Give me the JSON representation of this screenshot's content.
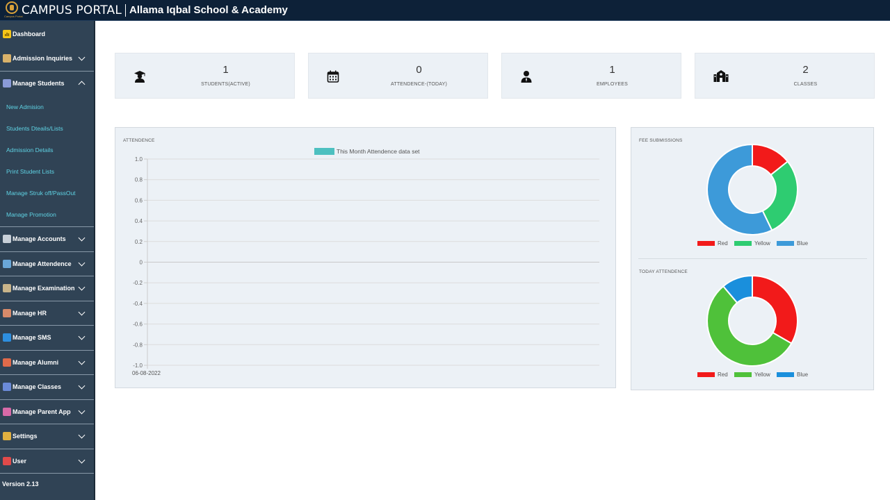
{
  "header": {
    "brand": "CAMPUS PORTAL",
    "logo_caption": "Campus Portal",
    "school": "Allama Iqbal School & Academy"
  },
  "sidebar": {
    "dashboard": {
      "label": "Dashboard",
      "icon": "dashboard-icon",
      "color": "#f5c518"
    },
    "items": [
      {
        "label": "Admission Inquiries",
        "icon": "inquiries-icon",
        "color": "#d9b26a"
      },
      {
        "label": "Manage Students",
        "icon": "students-icon",
        "color": "#8a9bd8",
        "expanded": true,
        "children": [
          "New Admision",
          "Students Dteails/Lists",
          "Admission Details",
          "Print Student Lists",
          "Manage Struk off/PassOut",
          "Manage Promotion"
        ]
      },
      {
        "label": "Manage Accounts",
        "icon": "bank-icon",
        "color": "#c8d0d8"
      },
      {
        "label": "Manage Attendence",
        "icon": "attendance-icon",
        "color": "#6aa7d8"
      },
      {
        "label": "Manage Examination",
        "icon": "exam-icon",
        "color": "#c8b48a"
      },
      {
        "label": "Manage HR",
        "icon": "hr-icon",
        "color": "#d88a6a"
      },
      {
        "label": "Manage SMS",
        "icon": "sms-icon",
        "color": "#2d8fe0"
      },
      {
        "label": "Manage Alumni",
        "icon": "alumni-icon",
        "color": "#e06a4a"
      },
      {
        "label": "Manage Classes",
        "icon": "classes-icon",
        "color": "#6a8ad8"
      },
      {
        "label": "Manage Parent App",
        "icon": "parent-app-icon",
        "color": "#d86aa8"
      },
      {
        "label": "Settings",
        "icon": "settings-icon",
        "color": "#e0b040"
      },
      {
        "label": "User",
        "icon": "user-icon",
        "color": "#e04a4a"
      }
    ],
    "version": "Version 2.13"
  },
  "stats": [
    {
      "value": "1",
      "caption": "STUDENTS(ACTIVE)",
      "icon": "graduate-icon"
    },
    {
      "value": "0",
      "caption": "ATTENDENCE-(TODAY)",
      "icon": "calendar-icon"
    },
    {
      "value": "1",
      "caption": "EMPLOYEES",
      "icon": "employee-icon"
    },
    {
      "value": "2",
      "caption": "CLASSES",
      "icon": "school-building-icon"
    }
  ],
  "attendance_panel": {
    "title": "ATTENDENCE"
  },
  "fee_panel": {
    "title": "FEE SUBMISSIONS"
  },
  "today_panel": {
    "title": "TODAY ATTENDENCE"
  },
  "chart_data": [
    {
      "type": "line",
      "legend": [
        "This Month Attendence data set"
      ],
      "legend_color": "#4dc0c0",
      "x": [
        "06-08-2022"
      ],
      "series": [
        {
          "name": "This Month Attendence data set",
          "values": []
        }
      ],
      "ylim": [
        -1.0,
        1.0
      ],
      "yticks": [
        "1.0",
        "0.8",
        "0.6",
        "0.4",
        "0.2",
        "0",
        "-0.2",
        "-0.4",
        "-0.6",
        "-0.8",
        "-1.0"
      ],
      "grid": true,
      "legend_position": "top"
    },
    {
      "type": "pie",
      "donut": true,
      "labels": [
        "Red",
        "Yellow",
        "Blue"
      ],
      "colors": [
        "#f21a1a",
        "#2ecc71",
        "#3d9ad9"
      ],
      "values": [
        1,
        2,
        4
      ],
      "legend_position": "bottom"
    },
    {
      "type": "pie",
      "donut": true,
      "labels": [
        "Red",
        "Yellow",
        "Blue"
      ],
      "colors": [
        "#f21a1a",
        "#4fc13a",
        "#1a8fdc"
      ],
      "values": [
        3,
        5,
        1
      ],
      "legend_position": "bottom"
    }
  ]
}
